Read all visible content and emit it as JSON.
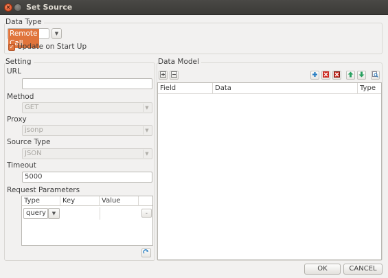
{
  "window": {
    "title": "Set Source"
  },
  "data_type": {
    "group_label": "Data Type",
    "selected": "Remote Call",
    "update_on_startup": {
      "label": "Update on Start Up",
      "checked": true
    }
  },
  "setting": {
    "group_label": "Setting",
    "url": {
      "label": "URL",
      "value": ""
    },
    "method": {
      "label": "Method",
      "value": "GET"
    },
    "proxy": {
      "label": "Proxy",
      "value": "jsonp"
    },
    "source_type": {
      "label": "Source Type",
      "value": "JSON"
    },
    "timeout": {
      "label": "Timeout",
      "value": "5000"
    },
    "request_parameters": {
      "label": "Request Parameters",
      "columns": [
        "Type",
        "Key",
        "Value"
      ],
      "rows": [
        {
          "type": "query",
          "key": "",
          "value": "",
          "remove": "-"
        }
      ]
    }
  },
  "data_model": {
    "group_label": "Data Model",
    "columns": [
      "Field",
      "Data",
      "Type"
    ]
  },
  "icons": {
    "close": "close-icon",
    "minimize": "minimize-icon",
    "expand_all": "expand-all-icon",
    "collapse_all": "collapse-all-icon",
    "add": "add-icon",
    "delete": "delete-icon",
    "delete_all": "delete-all-icon",
    "move_up": "move-up-icon",
    "move_down": "move-down-icon",
    "preview": "preview-icon",
    "add_param": "add-parameter-icon"
  },
  "colors": {
    "accent": "#e0743c",
    "titlebar": "#3f3e3b",
    "blue_icon": "#2a7fc3",
    "red_icon": "#cc2a20"
  },
  "footer": {
    "ok_label": "OK",
    "cancel_label": "CANCEL"
  }
}
